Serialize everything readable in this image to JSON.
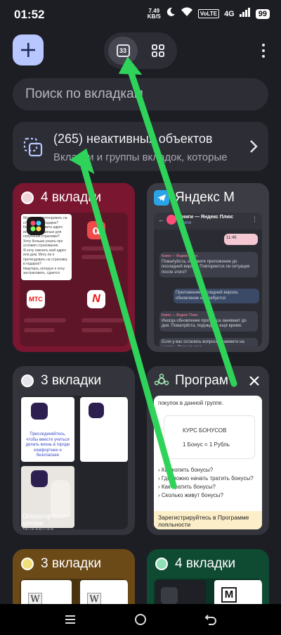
{
  "status_bar": {
    "time": "01:52",
    "speed_value": "7.49",
    "speed_unit": "KB/S",
    "volte": "VoLTE",
    "network": "4G",
    "battery": "99",
    "icons": [
      "signal-icon",
      "moon-icon",
      "wifi-icon",
      "wifi-signal-icon",
      "signal-bars-icon",
      "battery-icon"
    ]
  },
  "toolbar": {
    "add_icon": "plus-icon",
    "tab_count": "33",
    "grid_icon": "grid-icon",
    "menu_icon": "more-vert-icon"
  },
  "search": {
    "placeholder": "Поиск по вкладкам"
  },
  "inactive": {
    "title": "(265) неактивных объектов",
    "subtitle": "Вкладки и группы вкладок, которые",
    "icon": "copy-tabs-icon",
    "chevron": "chevron-right-icon"
  },
  "cards": [
    {
      "title": "4 вкладки",
      "color": "#7b1631",
      "preview_text": [
        "Могу ли я претендовать на страховку и подарок?",
        "Как мне обновить адрес или другие данные для получения страховки?",
        "Хочу больше узнать про условия страхования.",
        "Я хочу сменить мой адрес или дом. Могу ли я претендовать на страховку в подарок?",
        "Квартира, которую я хочу застраховать, сдается"
      ]
    },
    {
      "title": "Яндекс М",
      "header": "Книги — Яндекс Плюс",
      "subheader": "в сети",
      "messages": [
        {
          "sender": "Книги — Яндекс Плюс",
          "text": "Пожалуйста, обновите приложение до последней версии. Повторяется ли ситуация после этого?",
          "time": "11:47"
        },
        {
          "sender": "",
          "text": "Приложение последней версии, обновление не требуется",
          "time": "13:42"
        },
        {
          "sender": "Книги — Яндекс Плюс",
          "text": "Иногда обновление прогресса занимает до дня. Пожалуйста, подождите ещё время.",
          "time": "13:46"
        },
        {
          "sender": "",
          "text": "Если у вас остались вопросы, нажмите на кнопку «Вернуться в",
          "time": ""
        }
      ],
      "reply_time": "11:46"
    },
    {
      "title": "3 вкладки",
      "color": "#34353c",
      "preview_text": [
        "Присоединяйтесь, чтобы вместе учиться делать жизнь в городе комфортнее и безопаснее"
      ],
      "bottom_caption": "Оператор колл-центра (входящая"
    },
    {
      "title": "Програм",
      "intro": "покупок в данной группе.",
      "bonus_title": "КУРС БОНУСОВ",
      "bonus_rate": "1 Бонус = 1 Рубль",
      "faq": [
        "› Как копить бонусы?",
        "› Где можно начать тратить бонусы?",
        "› Как тратить бонусы?",
        "› Сколько живут бонусы?"
      ],
      "footer": "Зарегистрируйтесь в Программе лояльности"
    },
    {
      "title": "3 вкладки",
      "color": "#6b4a17"
    },
    {
      "title": "4 вкладки",
      "color": "#0f4a33"
    }
  ],
  "navbar": {
    "icons": [
      "menu-nav-icon",
      "home-nav-icon",
      "back-nav-icon"
    ]
  },
  "annotation": {
    "arrow_color": "#2fd35a"
  }
}
